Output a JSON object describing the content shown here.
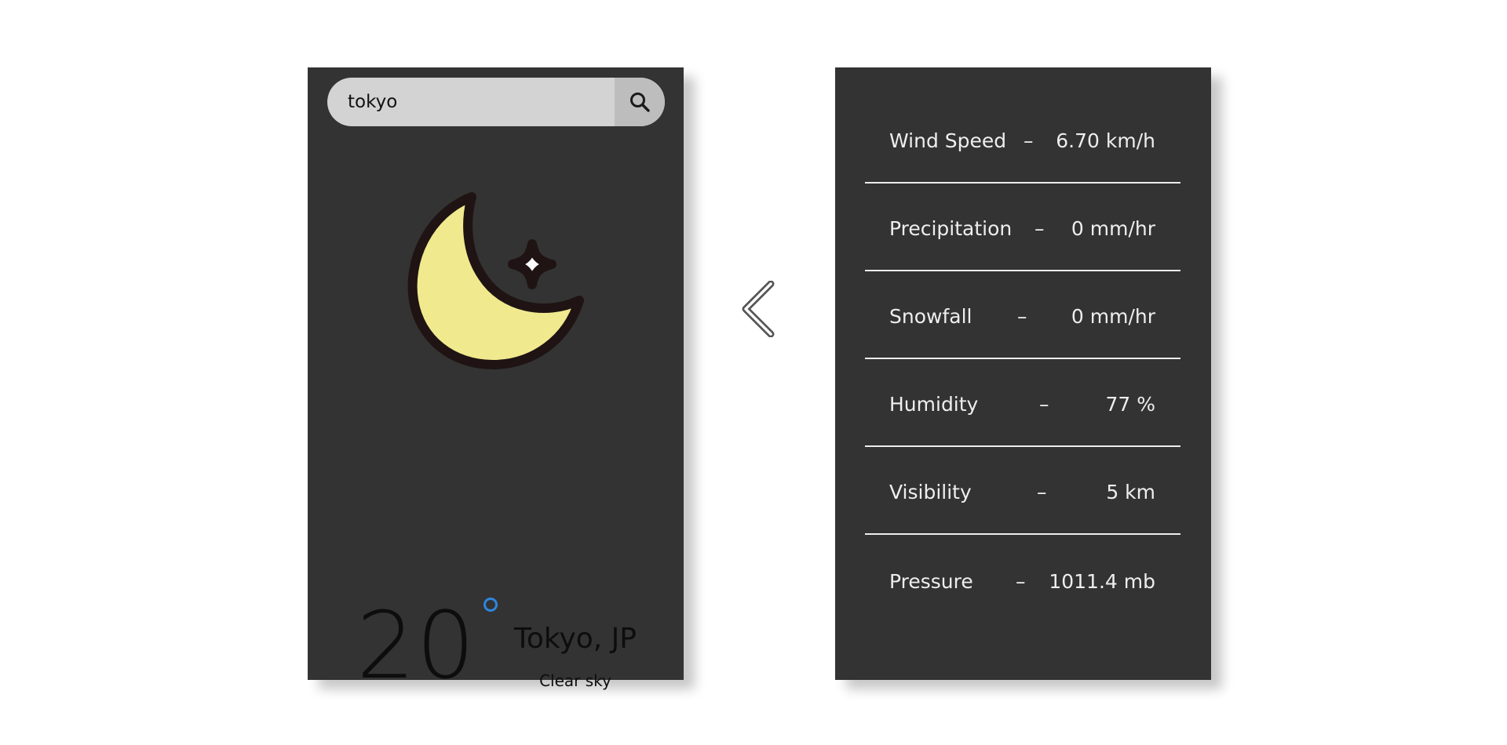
{
  "search": {
    "value": "tokyo",
    "button_icon": "search-icon"
  },
  "current": {
    "icon": "moon-star-icon",
    "temperature": "20",
    "city": "Tokyo, JP",
    "condition": "Clear sky"
  },
  "toggle": {
    "icon": "chevron-left-icon"
  },
  "details": [
    {
      "label": "Wind Speed",
      "separator": "–",
      "value": "6.70 km/h"
    },
    {
      "label": "Precipitation",
      "separator": "–",
      "value": "0 mm/hr"
    },
    {
      "label": "Snowfall",
      "separator": "–",
      "value": "0 mm/hr"
    },
    {
      "label": "Humidity",
      "separator": "–",
      "value": "77 %"
    },
    {
      "label": "Visibility",
      "separator": "–",
      "value": "5 km"
    },
    {
      "label": "Pressure",
      "separator": "–",
      "value": "1011.4 mb"
    }
  ],
  "colors": {
    "card_background": "#333333",
    "search_background": "#d3d3d3",
    "moon_fill": "#f1e98e",
    "icon_outline": "#1f1413",
    "degree_accent": "#2e86de",
    "detail_text": "#eeeeee"
  }
}
